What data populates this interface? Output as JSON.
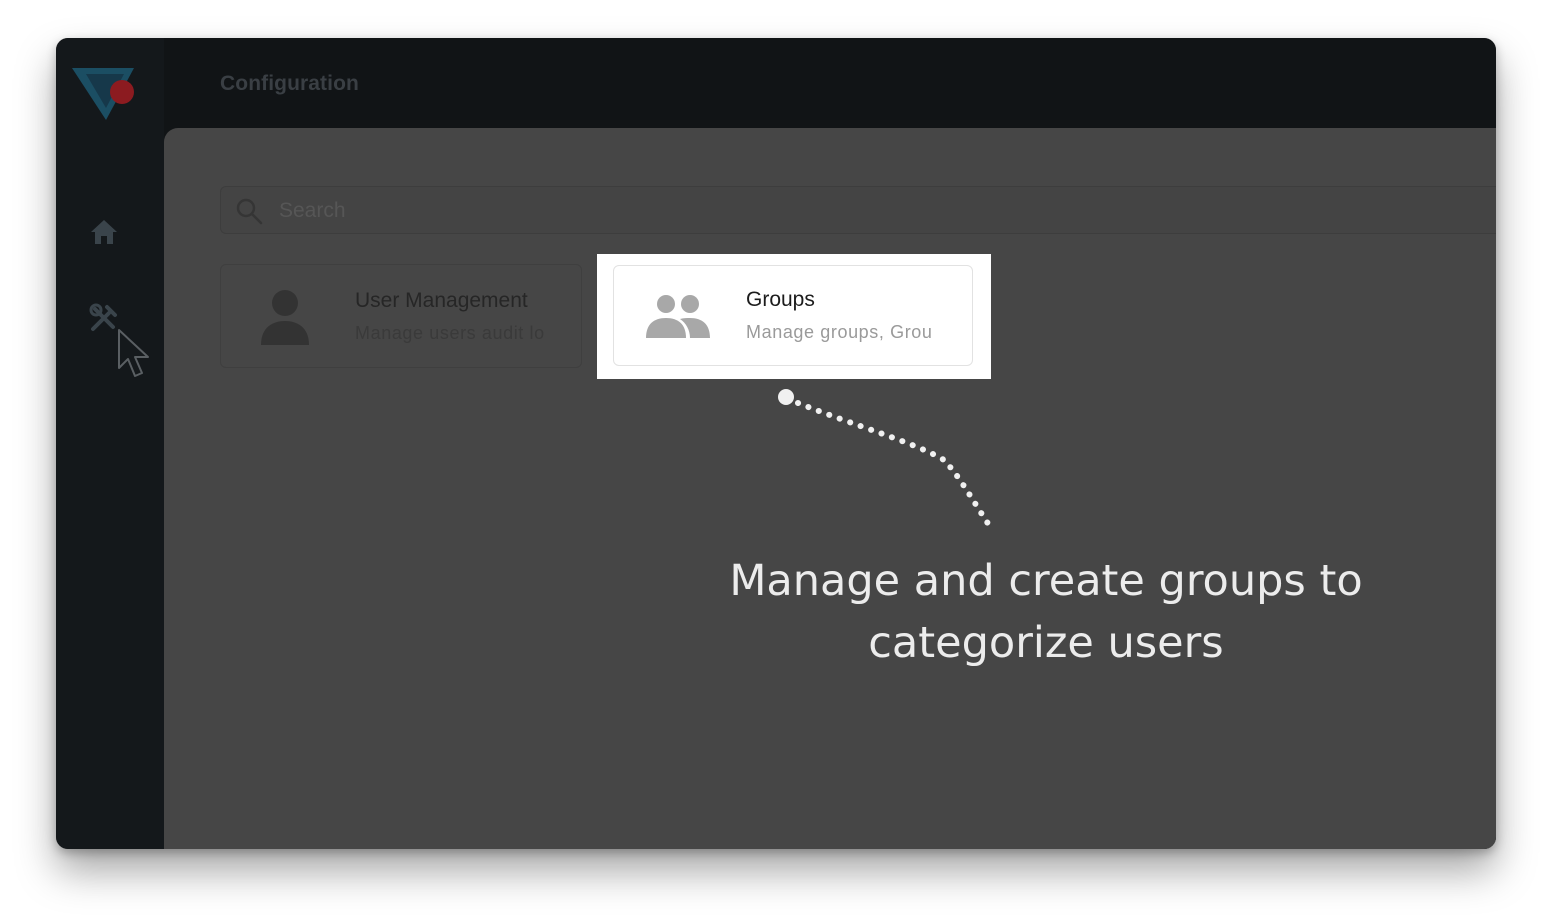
{
  "app": {
    "topbar_title": "Configuration",
    "search_placeholder": "Search",
    "nav": [
      {
        "icon": "home-icon"
      },
      {
        "icon": "tools-icon"
      }
    ]
  },
  "cards": {
    "user_management": {
      "title": "User Management",
      "description": "Manage users audit lo",
      "icon": "person-icon"
    },
    "groups": {
      "title": "Groups",
      "description": "Manage groups, Grou",
      "icon": "people-icon"
    }
  },
  "annotation": {
    "caption_line1": "Manage and create groups to",
    "caption_line2": "categorize users"
  },
  "colors": {
    "overlay_dim": "#464646",
    "sidebar": "#14181b",
    "logo_blue": "#1f6f8f",
    "logo_red": "#d8232e",
    "caption": "#ececec"
  }
}
